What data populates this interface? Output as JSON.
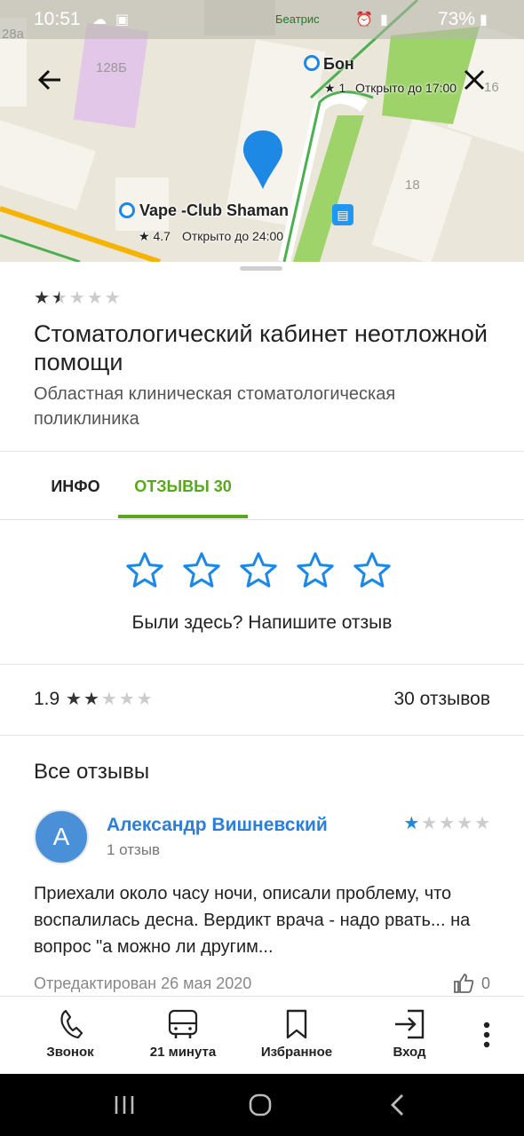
{
  "status_bar": {
    "time": "10:51",
    "battery": "73%",
    "street_top": "Беатрис"
  },
  "map": {
    "labels": {
      "house_28a": "28а",
      "house_128b": "128Б",
      "house_16": "16",
      "house_18": "18"
    },
    "poi_bon": {
      "name": "Бон",
      "rating": "★ 1",
      "hours": "Открыто до 17:00"
    },
    "poi_vape": {
      "name": "Vape -Club Shaman",
      "rating": "★ 4.7",
      "hours": "Открыто до 24:00"
    },
    "back_icon": "arrow-left-icon",
    "close_icon": "close-icon",
    "pin_color": "#1e88e5"
  },
  "place": {
    "rating_stars": 1.5,
    "title": "Стоматологический кабинет неотложной помощи",
    "subtitle": "Областная клиническая стоматологическая поликлиника"
  },
  "tabs": [
    {
      "label": "ИНФО",
      "active": false
    },
    {
      "label": "ОТЗЫВЫ 30",
      "active": true
    }
  ],
  "accent_color": "#58a81e",
  "rate_prompt": "Были здесь? Напишите отзыв",
  "summary": {
    "average": "1.9",
    "stars": 2,
    "count_label": "30 отзывов"
  },
  "reviews_heading": "Все отзывы",
  "review": {
    "avatar_letter": "А",
    "author": "Александр Вишневский",
    "author_reviews": "1 отзыв",
    "stars": 1,
    "text": "Приехали около часу ночи, описали проблему, что воспалилась десна. Вердикт врача - надо рвать... на вопрос \"а можно ли другим...",
    "edited": "Отредактирован 26 мая 2020",
    "likes": "0"
  },
  "bottom_bar": [
    {
      "label": "Звонок",
      "icon": "phone-icon"
    },
    {
      "label": "21 минута",
      "icon": "bus-icon"
    },
    {
      "label": "Избранное",
      "icon": "bookmark-icon"
    },
    {
      "label": "Вход",
      "icon": "login-icon"
    }
  ]
}
